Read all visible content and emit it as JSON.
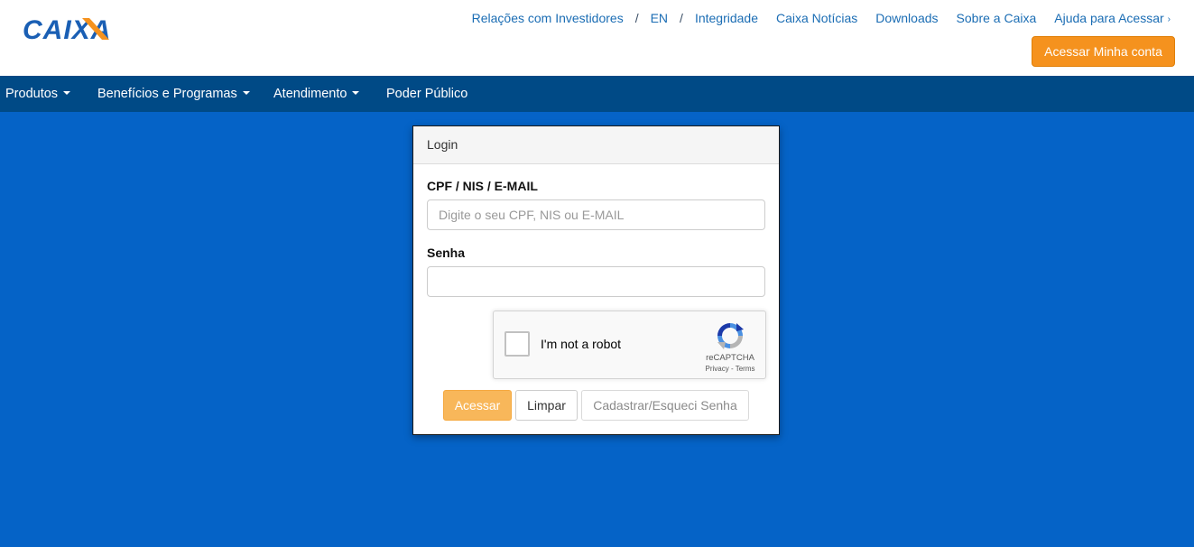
{
  "header": {
    "logo_text": "CAIXA",
    "links": [
      "Relações com Investidores",
      "EN",
      "Integridade",
      "Caixa Notícias",
      "Downloads",
      "Sobre a Caixa",
      "Ajuda para Acessar"
    ],
    "separator": "/",
    "chevron": "›",
    "account_button": "Acessar Minha conta"
  },
  "nav": {
    "items": [
      "Produtos",
      "Benefícios e Programas",
      "Atendimento",
      "Poder Público"
    ]
  },
  "login": {
    "title": "Login",
    "user_label": "CPF / NIS / E-MAIL",
    "user_placeholder": "Digite o seu CPF, NIS ou E-MAIL",
    "user_value": "",
    "password_label": "Senha",
    "password_value": "",
    "recaptcha": {
      "label": "I'm not a robot",
      "brand": "reCAPTCHA",
      "privacy": "Privacy",
      "dash": " - ",
      "terms": "Terms"
    },
    "buttons": {
      "submit": "Acessar",
      "clear": "Limpar",
      "register": "Cadastrar/Esqueci Senha"
    }
  },
  "colors": {
    "brand_blue": "#1a5fb4",
    "brand_orange": "#f5921e",
    "background_blue": "#0563c7",
    "nav_blue": "#004a86",
    "link_blue": "#1b6db4"
  },
  "icons": [
    "caixa-logo",
    "caret-down-icon",
    "chevron-right-icon",
    "recaptcha-logo-icon",
    "checkbox-icon"
  ]
}
